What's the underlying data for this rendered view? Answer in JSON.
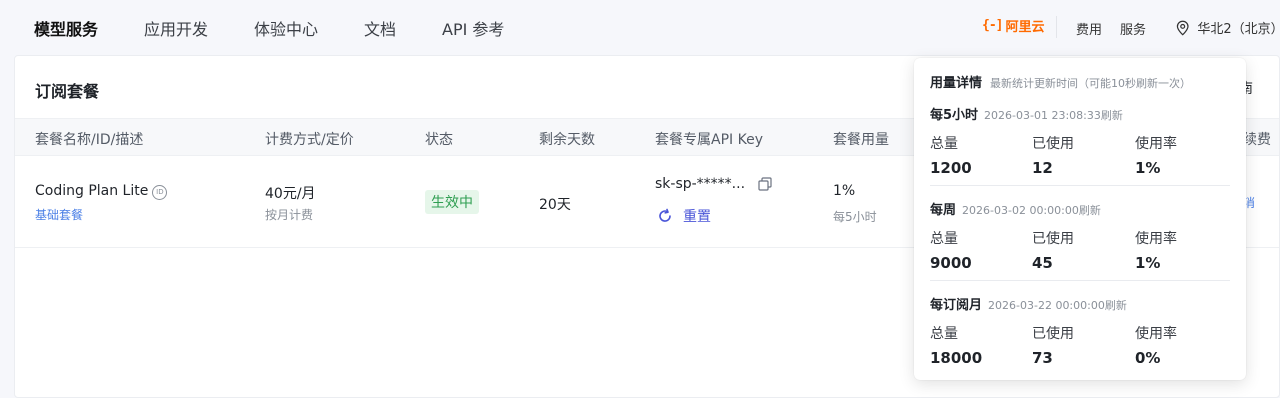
{
  "nav": {
    "items": [
      "模型服务",
      "应用开发",
      "体验中心",
      "文档",
      "API 参考"
    ],
    "brand": "阿里云",
    "brand_bracket": "{-]",
    "right_links": [
      "费用",
      "服务"
    ],
    "region": "华北2（北京）"
  },
  "card": {
    "title": "订阅套餐",
    "right_fragment": "南",
    "columns": [
      "套餐名称/ID/描述",
      "计费方式/定价",
      "状态",
      "剩余天数",
      "套餐专属API Key",
      "套餐用量"
    ],
    "right_col_fragment": "续费",
    "row": {
      "name": "Coding Plan Lite",
      "id_badge": "ID",
      "desc": "基础套餐",
      "price": "40元/月",
      "billing": "按月计费",
      "status": "生效中",
      "days_left": "20天",
      "api_key": "sk-sp-*****...",
      "reset_label": "重置",
      "usage": "1%",
      "usage_period": "每5小时",
      "right_fragment": "消"
    }
  },
  "popover": {
    "title": "用量详情",
    "note": "最新统计更新时间（可能10秒刷新一次）",
    "sections": [
      {
        "title": "每5小时",
        "time": "2026-03-01 23:08:33刷新",
        "labels": [
          "总量",
          "已使用",
          "使用率"
        ],
        "values": [
          "1200",
          "12",
          "1%"
        ]
      },
      {
        "title": "每周",
        "time": "2026-03-02 00:00:00刷新",
        "labels": [
          "总量",
          "已使用",
          "使用率"
        ],
        "values": [
          "9000",
          "45",
          "1%"
        ]
      },
      {
        "title": "每订阅月",
        "time": "2026-03-22 00:00:00刷新",
        "labels": [
          "总量",
          "已使用",
          "使用率"
        ],
        "values": [
          "18000",
          "73",
          "0%"
        ]
      }
    ]
  },
  "colors": {
    "brand": "#ff6a00",
    "status_bg": "#e6f6ea",
    "status_text": "#2f9e51",
    "link": "#4a7fe6",
    "reset": "#4a55d8"
  }
}
